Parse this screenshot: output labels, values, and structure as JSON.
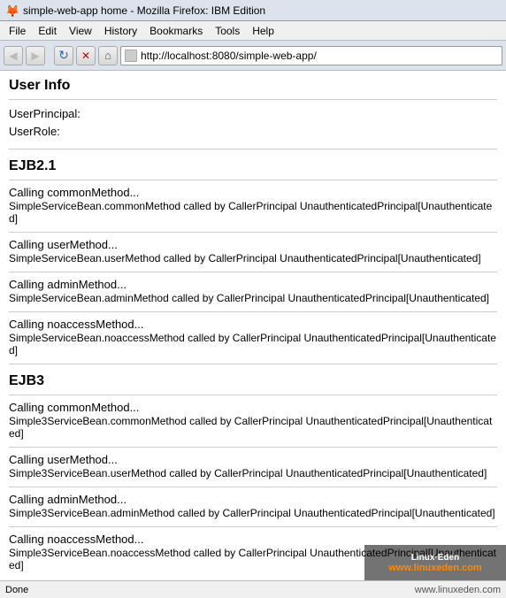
{
  "titlebar": {
    "icon": "🦊",
    "text": "simple-web-app home - Mozilla Firefox: IBM Edition"
  },
  "menubar": {
    "items": [
      "File",
      "Edit",
      "View",
      "History",
      "Bookmarks",
      "Tools",
      "Help"
    ]
  },
  "navbar": {
    "back_label": "◀",
    "forward_label": "▶",
    "reload_label": "↻",
    "stop_label": "✕",
    "home_label": "⌂",
    "address": "http://localhost:8080/simple-web-app/"
  },
  "page": {
    "title": "User Info",
    "user_principal_label": "UserPrincipal:",
    "user_role_label": "UserRole:",
    "ejb21_title": "EJB2.1",
    "ejb3_title": "EJB3",
    "methods": {
      "ejb21": [
        {
          "calling": "Calling commonMethod...",
          "result": "SimpleServiceBean.commonMethod called by CallerPrincipal UnauthenticatedPrincipal[Unauthenticated]"
        },
        {
          "calling": "Calling userMethod...",
          "result": "SimpleServiceBean.userMethod called by CallerPrincipal UnauthenticatedPrincipal[Unauthenticated]"
        },
        {
          "calling": "Calling adminMethod...",
          "result": "SimpleServiceBean.adminMethod called by CallerPrincipal UnauthenticatedPrincipal[Unauthenticated]"
        },
        {
          "calling": "Calling noaccessMethod...",
          "result": "SimpleServiceBean.noaccessMethod called by CallerPrincipal UnauthenticatedPrincipal[Unauthenticated]"
        }
      ],
      "ejb3": [
        {
          "calling": "Calling commonMethod...",
          "result": "Simple3ServiceBean.commonMethod called by CallerPrincipal UnauthenticatedPrincipal[Unauthenticated]"
        },
        {
          "calling": "Calling userMethod...",
          "result": "Simple3ServiceBean.userMethod called by CallerPrincipal UnauthenticatedPrincipal[Unauthenticated]"
        },
        {
          "calling": "Calling adminMethod...",
          "result": "Simple3ServiceBean.adminMethod called by CallerPrincipal UnauthenticatedPrincipal[Unauthenticated]"
        },
        {
          "calling": "Calling noaccessMethod...",
          "result": "Simple3ServiceBean.noaccessMethod called by CallerPrincipal UnauthenticatedPrincipal[Unauthenticated]"
        }
      ]
    }
  },
  "statusbar": {
    "left": "Done",
    "right": "www.linuxeden.com"
  }
}
